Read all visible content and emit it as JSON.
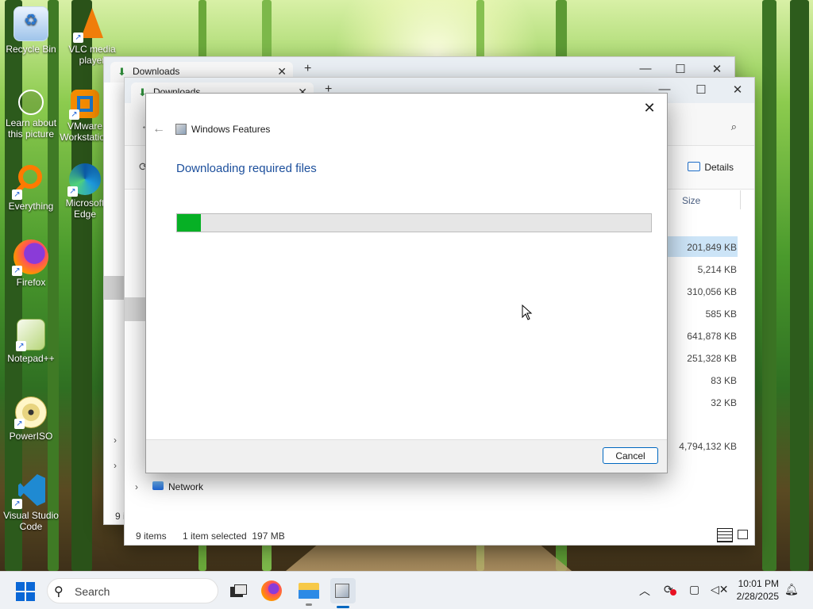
{
  "desktop": {
    "icons": [
      {
        "label": "Recycle Bin",
        "icon": "recycle-bin-icon"
      },
      {
        "label": "VLC media player",
        "icon": "vlc-icon"
      },
      {
        "label": "Learn about this picture",
        "icon": "learn-icon"
      },
      {
        "label": "VMware Workstation",
        "icon": "vmware-icon"
      },
      {
        "label": "Everything",
        "icon": "everything-icon"
      },
      {
        "label": "Microsoft Edge",
        "icon": "edge-icon"
      },
      {
        "label": "Firefox",
        "icon": "firefox-icon"
      },
      {
        "label": "Notepad++",
        "icon": "notepadpp-icon"
      },
      {
        "label": "PowerISO",
        "icon": "poweriso-icon"
      },
      {
        "label": "Visual Studio Code",
        "icon": "vscode-icon"
      }
    ]
  },
  "explorer_back": {
    "tab_title": "Downloads",
    "new_tab": "+",
    "minimize": "—",
    "maximize": "☐",
    "close": "✕",
    "status_count": "9 i"
  },
  "explorer_front": {
    "tab_title": "Downloads",
    "details_label": "Details",
    "size_header": "Size",
    "sizes": [
      "201,849 KB",
      "5,214 KB",
      "310,056 KB",
      "585 KB",
      "641,878 KB",
      "251,328 KB",
      "83 KB",
      "32 KB"
    ],
    "extra_size": "4,794,132 KB",
    "nav_network": "Network",
    "status_items": "9 items",
    "status_selected": "1 item selected  197 MB"
  },
  "dialog": {
    "title": "Windows Features",
    "heading": "Downloading required files",
    "progress_percent": 5,
    "cancel_label": "Cancel",
    "close": "✕",
    "back": "←"
  },
  "taskbar": {
    "search_label": "Search",
    "time": "10:01 PM",
    "date": "2/28/2025",
    "chevron": "︿"
  },
  "colors": {
    "progress_fill": "#06b025",
    "heading_blue": "#1c4f9c",
    "accent": "#0067c0"
  }
}
